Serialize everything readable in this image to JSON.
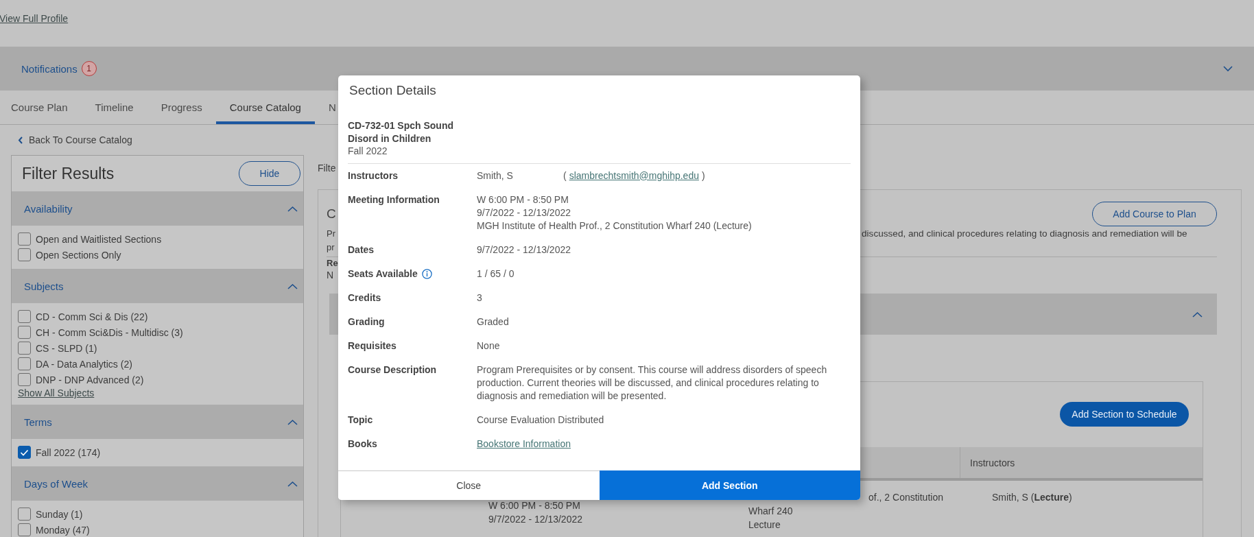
{
  "profile_link": "View Full Profile",
  "notifications": {
    "label": "Notifications",
    "count": "1",
    "expanded": false
  },
  "tabs": [
    {
      "label": "Course Plan",
      "selected": false
    },
    {
      "label": "Timeline",
      "selected": false
    },
    {
      "label": "Progress",
      "selected": false
    },
    {
      "label": "Course Catalog",
      "selected": true
    },
    {
      "label": "N",
      "selected": false
    }
  ],
  "back_link": "Back To Course Catalog",
  "filter": {
    "title": "Filter Results",
    "hide_button": "Hide",
    "groups": [
      {
        "title": "Availability",
        "expanded": true,
        "options": [
          {
            "label": "Open and Waitlisted Sections",
            "checked": false
          },
          {
            "label": "Open Sections Only",
            "checked": false
          }
        ]
      },
      {
        "title": "Subjects",
        "expanded": true,
        "options": [
          {
            "label": "CD - Comm Sci & Dis (22)",
            "checked": false
          },
          {
            "label": "CH - Comm Sci&Dis - Multidisc (3)",
            "checked": false
          },
          {
            "label": "CS - SLPD (1)",
            "checked": false
          },
          {
            "label": "DA - Data Analytics (2)",
            "checked": false
          },
          {
            "label": "DNP - DNP Advanced (2)",
            "checked": false
          }
        ],
        "show_all": "Show All Subjects"
      },
      {
        "title": "Terms",
        "expanded": true,
        "options": [
          {
            "label": "Fall 2022 (174)",
            "checked": true
          }
        ]
      },
      {
        "title": "Days of Week",
        "expanded": true,
        "options": [
          {
            "label": "Sunday (1)",
            "checked": false
          },
          {
            "label": "Monday (47)",
            "checked": false
          }
        ]
      }
    ]
  },
  "results": {
    "filter_label": "Filte",
    "course": {
      "title": "C",
      "add_button": "Add Course to Plan",
      "description_left": [
        "Pr",
        "pr"
      ],
      "description_right": "discussed, and clinical procedures relating to diagnosis and remediation will be",
      "requisites_label": "Re",
      "requisites_value": "N",
      "section_panel": {
        "expanded": true,
        "add_button": "Add Section to Schedule",
        "column_header": "Instructors",
        "meeting": [
          "W 6:00 PM - 8:50 PM",
          "9/7/2022 - 12/13/2022"
        ],
        "location": [
          "of., 2 Constitution",
          "Wharf 240",
          "Lecture"
        ],
        "instructor": "Smith, S (**Lecture**)"
      }
    }
  },
  "modal": {
    "title": "Section Details",
    "course_title": [
      "CD-732-01 Spch Sound",
      "Disord in Children"
    ],
    "term": "Fall 2022",
    "rows": [
      {
        "kind": "instructor",
        "label": "Instructors",
        "name": "Smith, S",
        "open": "(",
        "email": "slambrechtsmith@mghihp.edu",
        "close": ")"
      },
      {
        "kind": "lines",
        "label": "Meeting Information",
        "lines": [
          "W 6:00 PM - 8:50 PM",
          "9/7/2022 - 12/13/2022",
          "MGH Institute of Health Prof., 2 Constitution Wharf 240 (Lecture)"
        ]
      },
      {
        "kind": "text",
        "label": "Dates",
        "value": "9/7/2022 - 12/13/2022"
      },
      {
        "kind": "info",
        "label": "Seats Available",
        "value": "1 / 65 / 0"
      },
      {
        "kind": "text",
        "label": "Credits",
        "value": "3"
      },
      {
        "kind": "text",
        "label": "Grading",
        "value": "Graded"
      },
      {
        "kind": "text",
        "label": "Requisites",
        "value": "None"
      },
      {
        "kind": "text",
        "label": "Course Description",
        "value": "Program Prerequisites or by consent. This course will address disorders of speech production. Current theories will be discussed, and clinical procedures relating to diagnosis and remediation will be presented."
      },
      {
        "kind": "text",
        "label": "Topic",
        "value": "Course Evaluation Distributed"
      },
      {
        "kind": "link",
        "label": "Books",
        "value": "Bookstore Information"
      }
    ],
    "close_button": "Close",
    "add_button": "Add Section"
  }
}
